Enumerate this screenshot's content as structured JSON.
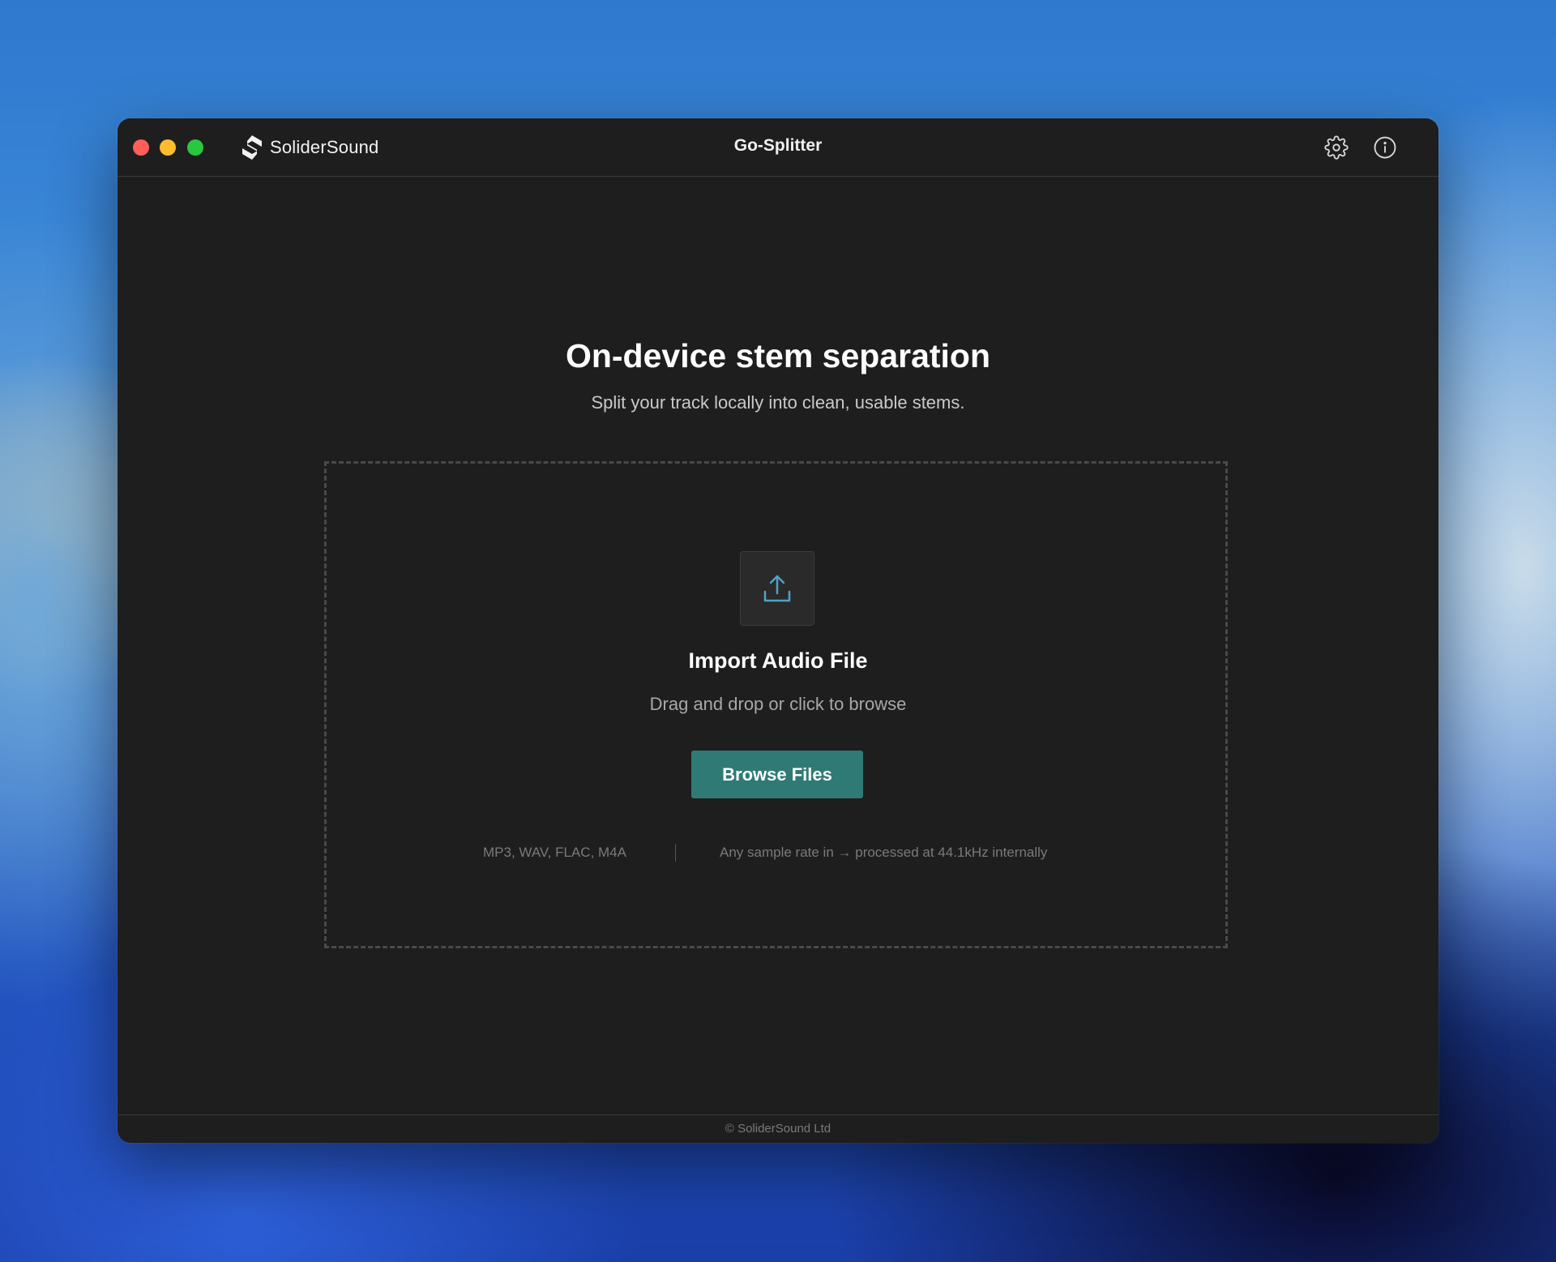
{
  "app": {
    "brand_name": "SoliderSound",
    "window_title": "Go-Splitter"
  },
  "titlebar": {
    "traffic_lights": [
      "close",
      "minimize",
      "maximize"
    ],
    "icons": [
      "gear-icon",
      "info-icon"
    ]
  },
  "hero": {
    "title": "On-device stem separation",
    "subtitle": "Split your track locally into clean, usable stems."
  },
  "dropzone": {
    "icon": "upload-icon",
    "title": "Import Audio File",
    "hint": "Drag and drop or click to browse",
    "button_label": "Browse Files",
    "formats": "MP3, WAV, FLAC, M4A",
    "sample_rate_note": "Any sample rate in → processed at 44.1kHz internally"
  },
  "footer": {
    "copyright": "© SoliderSound Ltd"
  },
  "colors": {
    "window_bg": "#1e1e1e",
    "accent_button": "#2f7a74",
    "upload_icon": "#4fa3c7",
    "close": "#ff5f57",
    "minimize": "#febc2e",
    "maximize": "#28c840"
  }
}
